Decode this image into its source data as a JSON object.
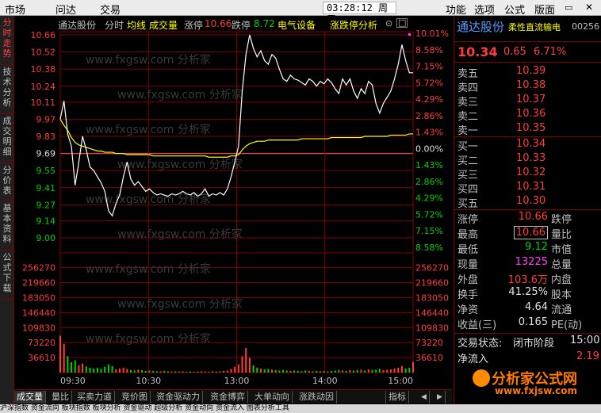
{
  "menu": {
    "items": [
      "市场",
      "问达",
      "交易"
    ],
    "right_items": [
      "功能",
      "选项",
      "公式",
      "版面"
    ]
  },
  "clock": "03:28:12 周三",
  "left_tabs": [
    {
      "label": "分时走势",
      "active": true
    },
    {
      "label": "技术分析",
      "active": false
    },
    {
      "label": "成交明细",
      "active": false
    },
    {
      "label": "分价表",
      "active": false
    },
    {
      "label": "基本资料",
      "active": false
    },
    {
      "label": "公式下载",
      "active": false
    }
  ],
  "chart_header": {
    "name": "通达股份",
    "mode": "分时",
    "ma": "均线",
    "vol": "成交量",
    "up_label": "涨停",
    "up_value": "10.66",
    "down_label": "跌停",
    "down_value": "8.72",
    "sector": "电气设备",
    "analysis": "涨跌停分析"
  },
  "chart_data": {
    "type": "line",
    "prev_close": 9.69,
    "price_ticks": [
      "10.66",
      "10.52",
      "10.38",
      "10.24",
      "10.11",
      "9.97",
      "9.83",
      "9.69",
      "9.55",
      "9.41",
      "9.27",
      "9.14",
      "9.00"
    ],
    "pct_ticks": [
      "10.01%",
      "8.58%",
      "7.15%",
      "5.72%",
      "4.29%",
      "2.86%",
      "1.43%",
      "0.00%",
      "1.43%",
      "2.86%",
      "4.29%",
      "5.72%",
      "7.15%",
      "8.58%"
    ],
    "volume_ticks": [
      "256270",
      "219660",
      "183050",
      "146440",
      "109830",
      "73220",
      "36610"
    ],
    "time_ticks": [
      "09:30",
      "10:30",
      "13:00",
      "14:00",
      "15:00"
    ],
    "price": [
      9.97,
      10.12,
      9.85,
      9.75,
      9.43,
      9.62,
      9.83,
      9.72,
      9.58,
      9.55,
      9.5,
      9.45,
      9.38,
      9.22,
      9.18,
      9.28,
      9.35,
      9.5,
      9.62,
      9.48,
      9.43,
      9.46,
      9.42,
      9.38,
      9.4,
      9.37,
      9.35,
      9.36,
      9.35,
      9.34,
      9.36,
      9.35,
      9.36,
      9.38,
      9.36,
      9.35,
      9.37,
      9.34,
      9.36,
      9.4,
      9.34,
      9.36,
      9.35,
      9.37,
      9.35,
      9.4,
      9.5,
      9.62,
      9.75,
      10.2,
      10.5,
      10.66,
      10.55,
      10.48,
      10.53,
      10.45,
      10.42,
      10.5,
      10.47,
      10.38,
      10.3,
      10.28,
      10.33,
      10.3,
      10.29,
      10.27,
      10.25,
      10.3,
      10.28,
      10.24,
      10.28,
      10.26,
      10.3,
      10.27,
      10.22,
      10.18,
      10.3,
      10.25,
      10.3,
      10.2,
      10.14,
      10.22,
      10.18,
      10.28,
      10.25,
      10.1,
      10.02,
      10.1,
      10.15,
      10.2,
      10.3,
      10.42,
      10.58,
      10.45,
      10.35,
      10.35
    ],
    "avg": [
      9.97,
      9.92,
      9.88,
      9.82,
      9.78,
      9.76,
      9.75,
      9.74,
      9.73,
      9.72,
      9.71,
      9.71,
      9.7,
      9.7,
      9.7,
      9.69,
      9.69,
      9.69,
      9.68,
      9.68,
      9.68,
      9.68,
      9.68,
      9.68,
      9.68,
      9.67,
      9.67,
      9.67,
      9.67,
      9.67,
      9.67,
      9.67,
      9.67,
      9.67,
      9.67,
      9.67,
      9.67,
      9.67,
      9.67,
      9.67,
      9.66,
      9.66,
      9.66,
      9.66,
      9.66,
      9.66,
      9.67,
      9.67,
      9.68,
      9.72,
      9.75,
      9.77,
      9.78,
      9.79,
      9.79,
      9.79,
      9.8,
      9.8,
      9.8,
      9.8,
      9.8,
      9.8,
      9.8,
      9.8,
      9.8,
      9.81,
      9.81,
      9.81,
      9.81,
      9.81,
      9.81,
      9.81,
      9.81,
      9.82,
      9.82,
      9.82,
      9.82,
      9.82,
      9.82,
      9.82,
      9.82,
      9.82,
      9.83,
      9.83,
      9.83,
      9.83,
      9.83,
      9.83,
      9.83,
      9.84,
      9.84,
      9.84,
      9.84,
      9.84,
      9.85,
      9.85
    ],
    "volume": [
      90000,
      70000,
      40000,
      25000,
      30000,
      18000,
      22000,
      15000,
      12000,
      10000,
      12000,
      9000,
      14000,
      20000,
      16000,
      8000,
      10000,
      12000,
      9000,
      6000,
      5000,
      7000,
      6000,
      4000,
      5000,
      4000,
      3500,
      3000,
      4000,
      3000,
      2500,
      3000,
      2500,
      3000,
      2000,
      2500,
      2000,
      2500,
      3000,
      2500,
      2000,
      3000,
      2500,
      3000,
      4000,
      5000,
      9000,
      14000,
      20000,
      40000,
      60000,
      36000,
      18000,
      12000,
      10000,
      8000,
      9000,
      7000,
      6000,
      5000,
      6000,
      5000,
      4000,
      5000,
      4000,
      3500,
      5000,
      4000,
      3000,
      4000,
      3500,
      4000,
      3000,
      4000,
      5000,
      6000,
      5000,
      4000,
      6000,
      5000,
      6000,
      7000,
      5000,
      8000,
      6000,
      7000,
      9000,
      6000,
      7000,
      8000,
      10000,
      12000,
      16000,
      10000,
      12000,
      26000
    ]
  },
  "quote": {
    "name": "通达股份",
    "subtitle": "柔性直流输电",
    "code": "00256",
    "price": "10.34",
    "change": "0.65",
    "change_pct": "6.71%",
    "asks": [
      {
        "label": "卖五",
        "price": "10.39"
      },
      {
        "label": "卖四",
        "price": "10.38"
      },
      {
        "label": "卖三",
        "price": "10.37"
      },
      {
        "label": "卖二",
        "price": "10.36"
      },
      {
        "label": "卖一",
        "price": "10.35"
      }
    ],
    "bids": [
      {
        "label": "买一",
        "price": "10.34"
      },
      {
        "label": "买二",
        "price": "10.33"
      },
      {
        "label": "买三",
        "price": "10.32"
      },
      {
        "label": "买四",
        "price": "10.31"
      },
      {
        "label": "买五",
        "price": "10.30"
      }
    ],
    "stats": [
      {
        "label": "涨停",
        "value": "10.66",
        "label2": "跌停",
        "color": "red"
      },
      {
        "label": "最高",
        "value": "10.66",
        "label2": "量比",
        "color": "red",
        "boxed": true
      },
      {
        "label": "最低",
        "value": "9.12",
        "label2": "市值",
        "color": "green"
      },
      {
        "label": "现量",
        "value": "13225",
        "label2": "总量",
        "color": "magenta"
      },
      {
        "label": "外盘",
        "value": "103.6万",
        "label2": "内盘",
        "color": "red"
      },
      {
        "label": "换手",
        "value": "41.25%",
        "label2": "股本",
        "color": "white"
      },
      {
        "label": "净资",
        "value": "4.64",
        "label2": "流通",
        "color": "white"
      },
      {
        "label": "收益(三)",
        "value": "0.165",
        "label2": "PE(动)",
        "color": "white"
      }
    ],
    "status_label": "交易状态:",
    "status_value": "闭市阶段",
    "status_time": "15:00",
    "net_inflow_label": "净流入",
    "net_inflow_value": "2.19"
  },
  "bottom_tabs": [
    {
      "label": "成交量",
      "active": true
    },
    {
      "label": "量比",
      "active": false
    },
    {
      "label": "买卖力道",
      "active": false
    },
    {
      "label": "竞价图",
      "active": false
    },
    {
      "label": "资金驱动力",
      "active": false
    },
    {
      "label": "资金博弈",
      "active": false
    },
    {
      "label": "大单动向",
      "active": false
    },
    {
      "label": "涨跌动因",
      "active": false
    }
  ],
  "bottom_right": {
    "indicator_label": "指标"
  },
  "bottom_strip": "沪深指数 资金流向 板块指数 板块分析 资金驱动 超级分析 资金动向 资金流入 图表分析工具",
  "watermark": "www.fxgsw.com  分析家",
  "logo": {
    "title": "分析家公式网",
    "url": "www.fxjsw.com"
  },
  "colors": {
    "up": "#ff3c3c",
    "down": "#00d000",
    "price_line": "#ffffff",
    "avg_line": "#ffff00",
    "grid": "#800000"
  }
}
